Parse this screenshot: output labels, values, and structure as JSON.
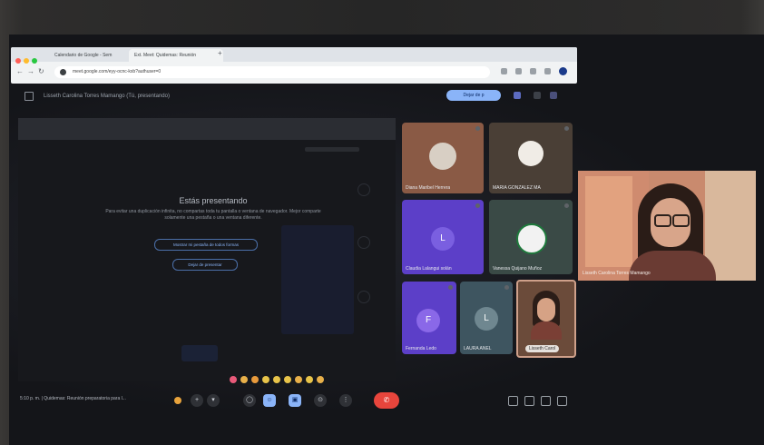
{
  "browser": {
    "tabs": [
      {
        "label": "Calendario de Google - Sem"
      },
      {
        "label": "Ext. Meet: Quidemas: Reunión"
      }
    ],
    "url": "meet.google.com/eyy-ocnc-kxb?authuser=0"
  },
  "meet": {
    "presenting_label": "Lisseth Carolina Torres Mamango (Tú, presentando)",
    "stop_button_label": "Dejar de p",
    "presenting_title": "Estás presentando",
    "presenting_description": "Para evitar una duplicación infinita, no compartas toda tu pantalla o ventana de navegador. Mejor comparte solamente una pestaña o una ventana diferente.",
    "share_tab_button": "Mostrar mi pestaña de todos formas",
    "stop_presenting_button": "Dejar de presentar"
  },
  "participants": [
    {
      "name": "Diana Maribel Herrera"
    },
    {
      "name": "MARIA GONZALEZ MA"
    },
    {
      "name": "Claudia Lalangui solán"
    },
    {
      "name": "Vanessa Quijano Muñoz"
    },
    {
      "name": "Fernanda Ledo",
      "initial": "F"
    },
    {
      "name": "LAURA ANEL",
      "initial": "L"
    },
    {
      "name": "Lisseth Carol"
    }
  ],
  "avatar_initials": {
    "claudia": "L"
  },
  "webcam": {
    "name": "Lisseth Carolina Torres Mamango"
  },
  "bottom_bar": {
    "meeting_info": "5:10 p. m.  |  Quidemas: Reunión preparatoria para l..."
  },
  "colors": {
    "accent_blue": "#8ab4f8",
    "end_call_red": "#e8453c",
    "tile_purple": "#5c3fc8",
    "tile_teal": "#3e5560"
  }
}
